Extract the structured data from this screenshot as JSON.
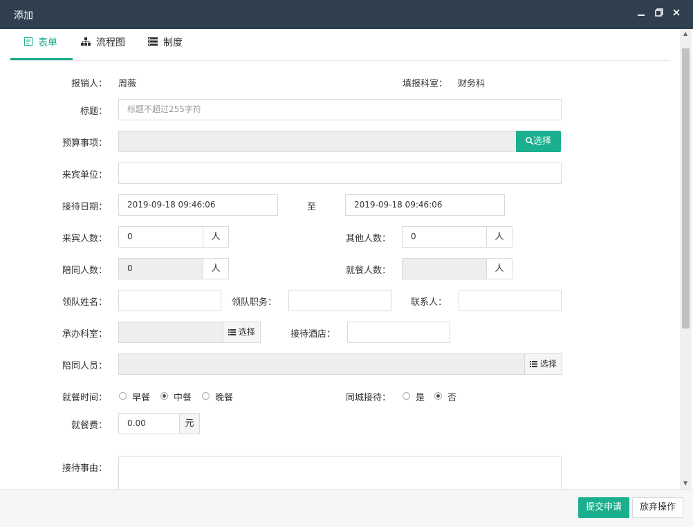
{
  "window": {
    "title": "添加",
    "minimize_icon": "minimize-icon",
    "maximize_icon": "restore-icon",
    "close_icon": "close-icon"
  },
  "tabs": [
    {
      "label": "表单",
      "icon": "form-icon",
      "active": true
    },
    {
      "label": "流程图",
      "icon": "flowchart-icon",
      "active": false
    },
    {
      "label": "制度",
      "icon": "list-icon",
      "active": false
    }
  ],
  "form": {
    "reporter_label": "报销人：",
    "reporter_value": "周薇",
    "dept_label": "填报科室：",
    "dept_value": "财务科",
    "title_label": "标题：",
    "title_placeholder": "标题不超过255字符",
    "budget_label": "预算事项：",
    "budget_select": "选择",
    "guest_unit_label": "来宾单位：",
    "date_label": "接待日期：",
    "date_from": "2019-09-18 09:46:06",
    "date_to_label": "至",
    "date_to": "2019-09-18 09:46:06",
    "guest_count_label": "来宾人数：",
    "guest_count": "0",
    "other_count_label": "其他人数：",
    "other_count": "0",
    "accompany_count_label": "陪同人数：",
    "accompany_count": "0",
    "meal_count_label": "就餐人数：",
    "unit_person": "人",
    "leader_name_label": "领队姓名：",
    "leader_title_label": "领队职务：",
    "contact_label": "联系人：",
    "handling_dept_label": "承办科室：",
    "handling_dept_select": "选择",
    "hotel_label": "接待酒店：",
    "accompany_staff_label": "陪同人员：",
    "accompany_staff_select": "选择",
    "meal_time_label": "就餐时间：",
    "meal_options": [
      "早餐",
      "中餐",
      "晚餐"
    ],
    "meal_selected": "中餐",
    "same_city_label": "同城接待：",
    "same_city_options": [
      "是",
      "否"
    ],
    "same_city_selected": "否",
    "meal_fee_label": "就餐费：",
    "meal_fee": "0.00",
    "meal_fee_unit": "元",
    "reason_label": "接待事由："
  },
  "footer": {
    "submit": "提交申请",
    "cancel": "放弃操作"
  },
  "colors": {
    "accent": "#1aaf8f",
    "titlebar": "#2f3f4f"
  }
}
